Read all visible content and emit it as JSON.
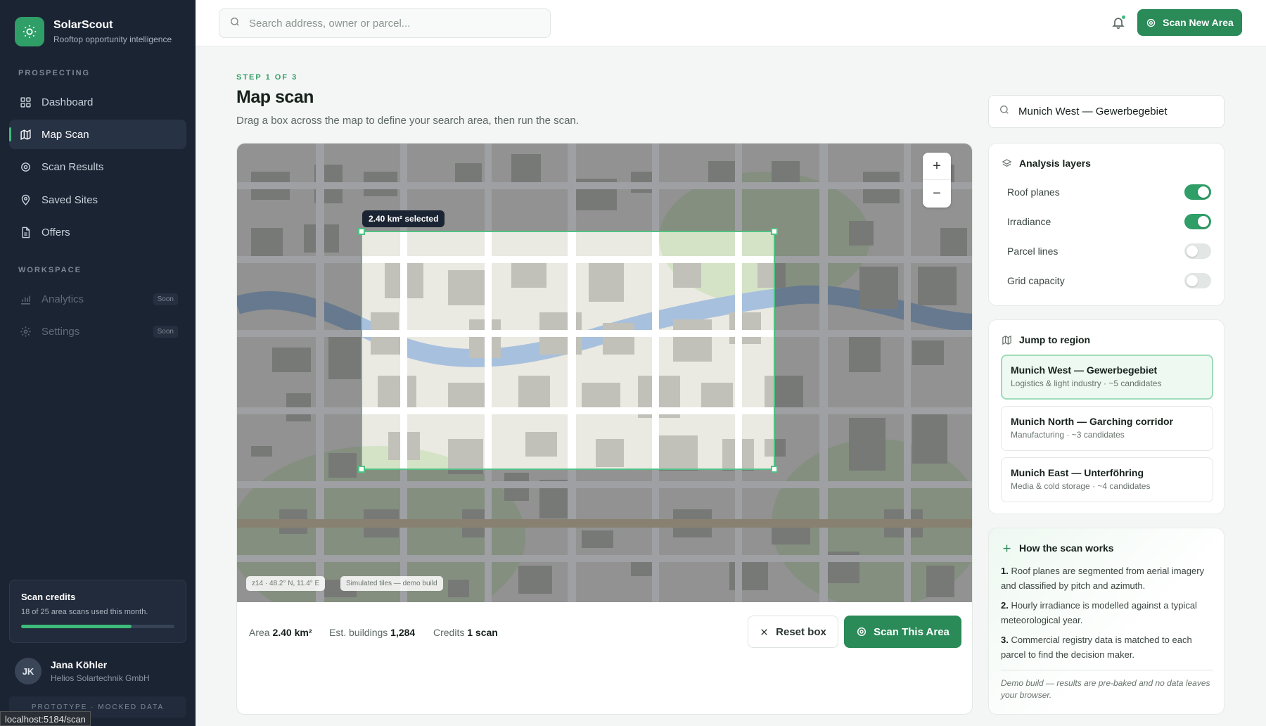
{
  "brand": {
    "name": "SolarScout",
    "tagline": "Rooftop opportunity intelligence"
  },
  "nav": {
    "section_prospecting": "PROSPECTING",
    "section_workspace": "WORKSPACE",
    "items": [
      {
        "label": "Dashboard",
        "icon": "dashboard-icon"
      },
      {
        "label": "Map Scan",
        "icon": "map-icon",
        "active": true
      },
      {
        "label": "Scan Results",
        "icon": "target-icon"
      },
      {
        "label": "Saved Sites",
        "icon": "pin-icon"
      },
      {
        "label": "Offers",
        "icon": "document-icon"
      },
      {
        "label": "Analytics",
        "icon": "chart-icon",
        "badge": "Soon"
      },
      {
        "label": "Settings",
        "icon": "gear-icon",
        "badge": "Soon"
      }
    ]
  },
  "credits": {
    "title": "Scan credits",
    "subtitle": "18 of 25 area scans used this month.",
    "used": 18,
    "total": 25
  },
  "user": {
    "initials": "JK",
    "name": "Jana Köhler",
    "org": "Helios Solartechnik GmbH"
  },
  "prototype_label": "PROTOTYPE · MOCKED DATA",
  "url_tooltip": "localhost:5184/scan",
  "topbar": {
    "search_placeholder": "Search address, owner or parcel...",
    "scan_new_label": "Scan New Area"
  },
  "page": {
    "step": "STEP 1 OF 3",
    "title": "Map scan",
    "description": "Drag a box across the map to define your search area, then run the scan."
  },
  "map": {
    "selection_label": "2.40 km² selected",
    "coords_chip": "z14 · 48.2° N, 11.4° E",
    "tiles_chip": "Simulated tiles — demo build",
    "zoom_in": "+",
    "zoom_out": "−"
  },
  "footer": {
    "area_label": "Area",
    "area_value": "2.40 km²",
    "buildings_label": "Est. buildings",
    "buildings_value": "1,284",
    "credits_label": "Credits",
    "credits_value": "1 scan",
    "reset_label": "Reset box",
    "scan_label": "Scan This Area"
  },
  "region_search_value": "Munich West — Gewerbegebiet",
  "layers": {
    "title": "Analysis layers",
    "items": [
      {
        "label": "Roof planes",
        "on": true
      },
      {
        "label": "Irradiance",
        "on": true
      },
      {
        "label": "Parcel lines",
        "on": false
      },
      {
        "label": "Grid capacity",
        "on": false
      }
    ]
  },
  "regions": {
    "title": "Jump to region",
    "items": [
      {
        "name": "Munich West — Gewerbegebiet",
        "sub": "Logistics & light industry · ~5 candidates",
        "selected": true
      },
      {
        "name": "Munich North — Garching corridor",
        "sub": "Manufacturing · ~3 candidates"
      },
      {
        "name": "Munich East — Unterföhring",
        "sub": "Media & cold storage · ~4 candidates"
      }
    ]
  },
  "how": {
    "title": "How the scan works",
    "steps": [
      {
        "num": "1.",
        "text": "Roof planes are segmented from aerial imagery and classified by pitch and azimuth."
      },
      {
        "num": "2.",
        "text": "Hourly irradiance is modelled against a typical meteorological year."
      },
      {
        "num": "3.",
        "text": "Commercial registry data is matched to each parcel to find the decision maker."
      }
    ],
    "note": "Demo build — results are pre-baked and no data leaves your browser."
  },
  "colors": {
    "accent": "#2f9e67",
    "sidebar": "#1b2433",
    "button": "#2a8a58"
  }
}
